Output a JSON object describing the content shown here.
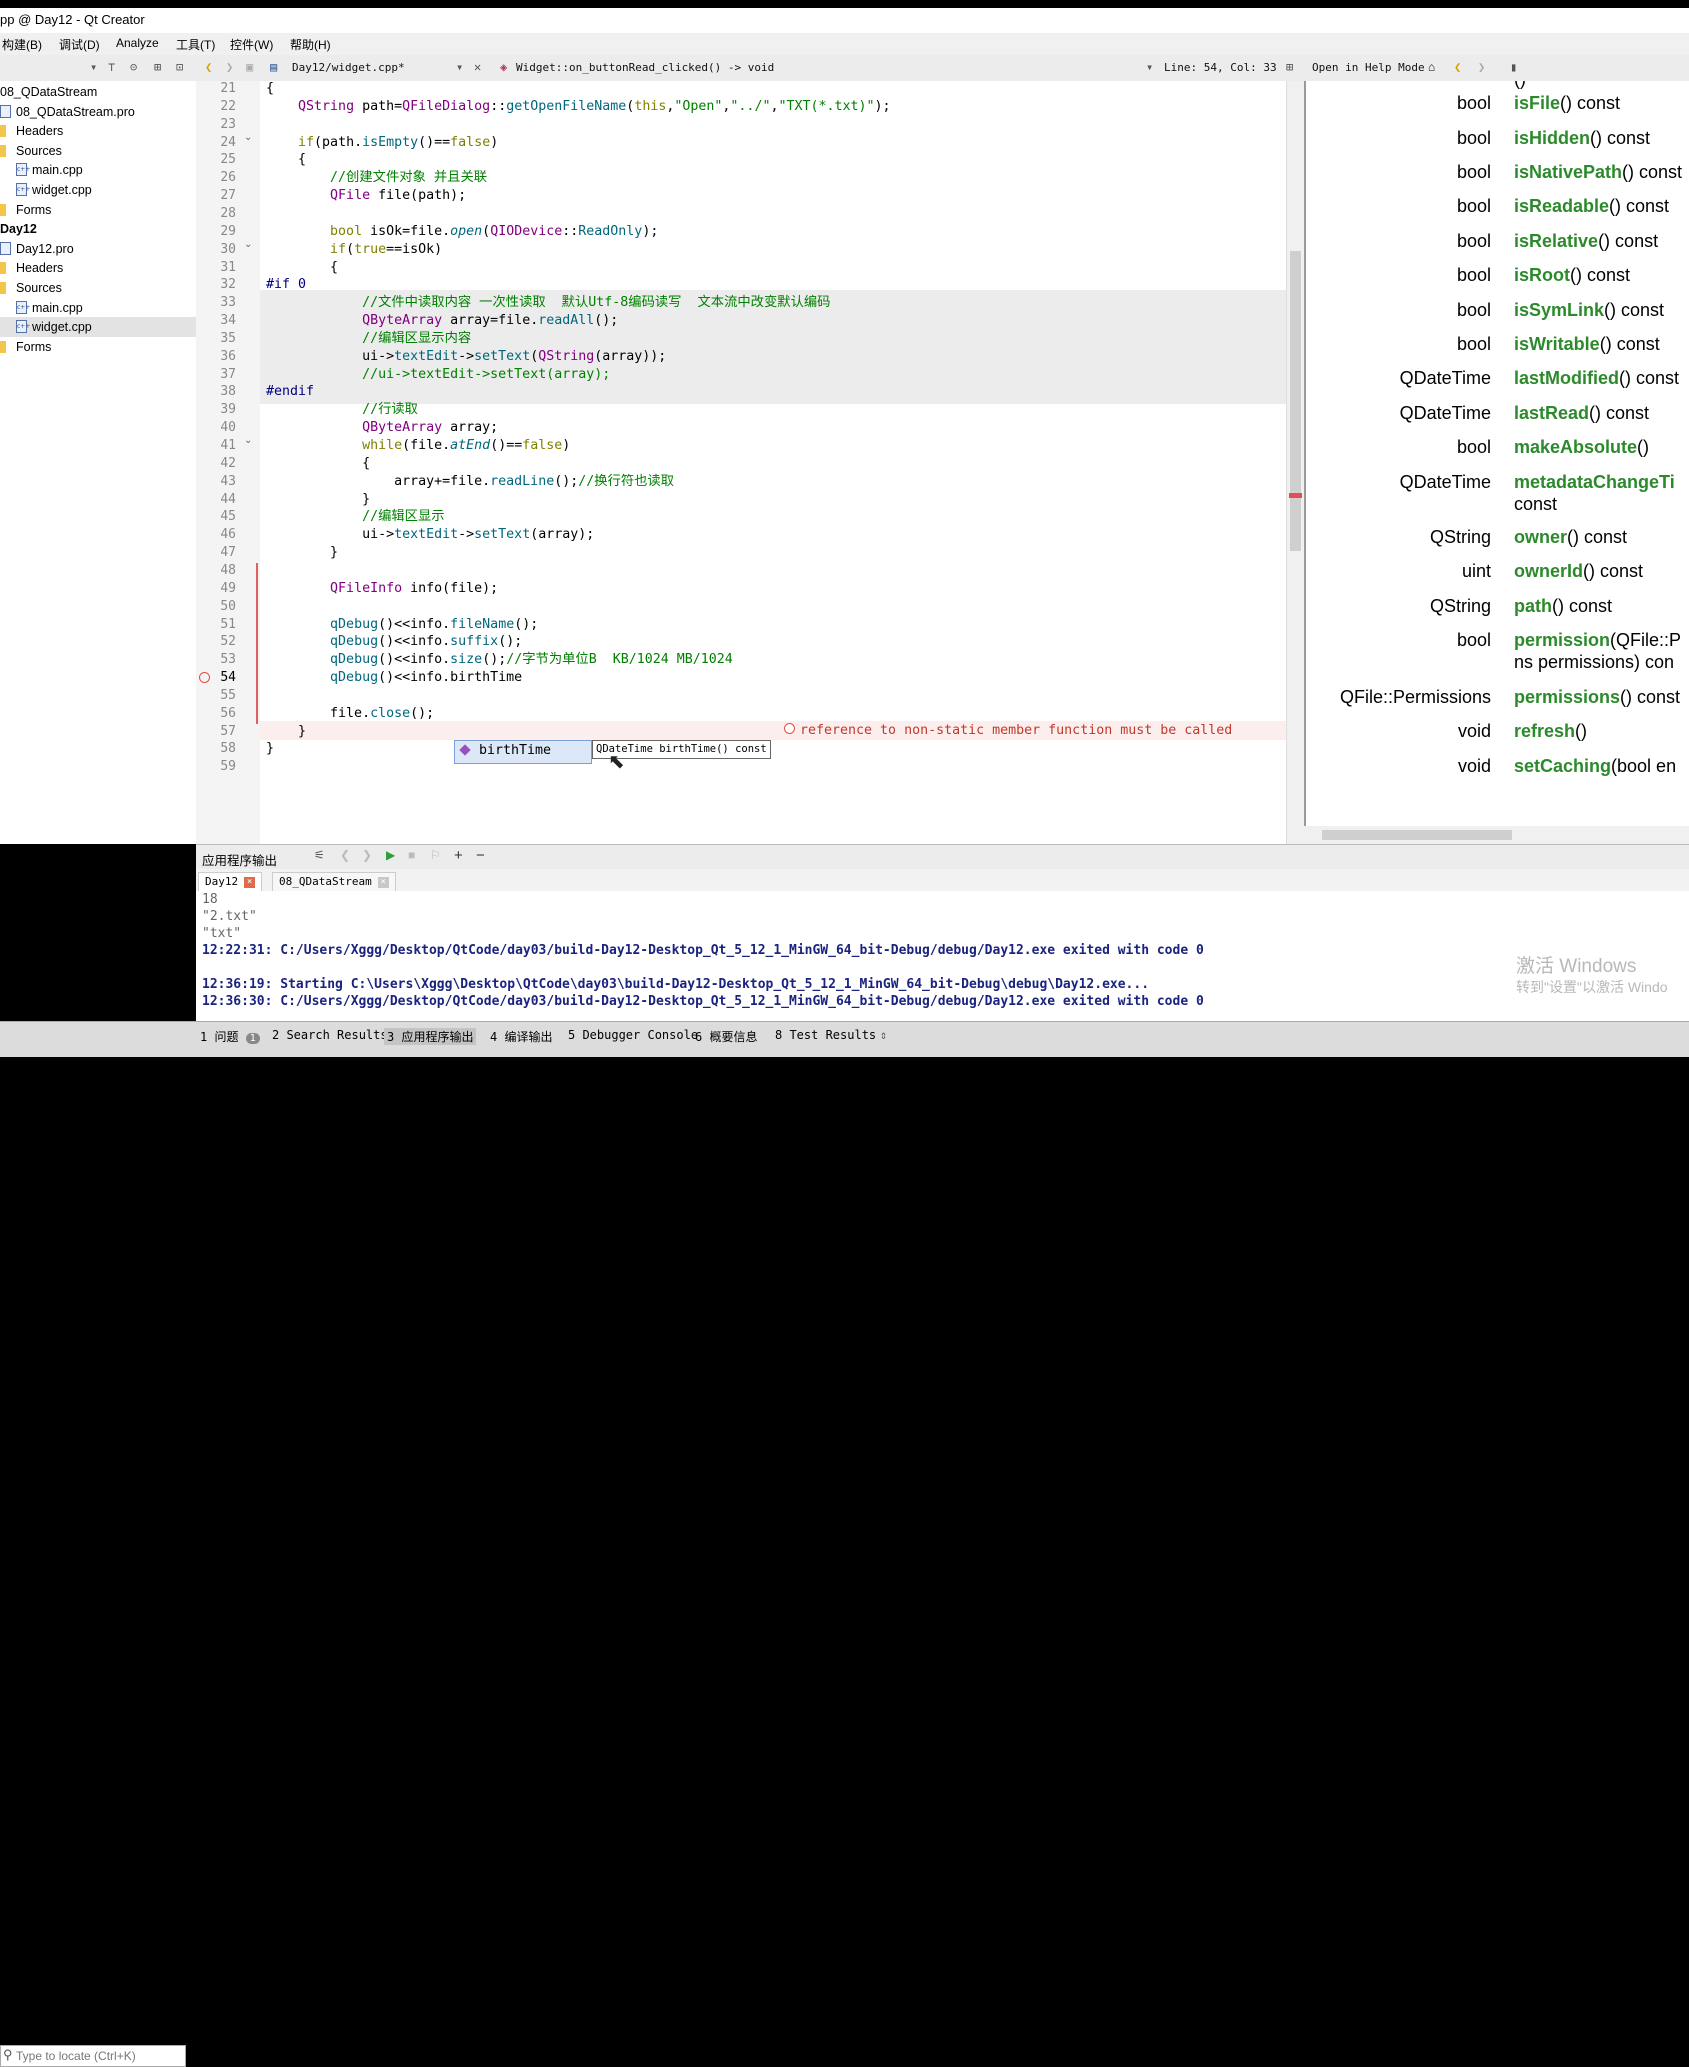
{
  "window": {
    "title": "pp @ Day12 - Qt Creator"
  },
  "menu": [
    "构建(B)",
    "调试(D)",
    "Analyze",
    "工具(T)",
    "控件(W)",
    "帮助(H)"
  ],
  "toolbar": {
    "file": "Day12/widget.cpp*",
    "symbol": "Widget::on_buttonRead_clicked() -> void",
    "position": "Line: 54, Col: 33",
    "help_mode": "Open in Help Mode"
  },
  "tree": [
    {
      "label": "08_QDataStream",
      "icon": "project-icon",
      "bold": false,
      "sel": false
    },
    {
      "label": "08_QDataStream.pro",
      "icon": "pro-file-icon",
      "bold": false,
      "sel": false
    },
    {
      "label": "Headers",
      "icon": "folder-icon",
      "bold": false,
      "sel": false
    },
    {
      "label": "Sources",
      "icon": "folder-icon",
      "bold": false,
      "sel": false
    },
    {
      "label": "main.cpp",
      "icon": "cpp-file-icon",
      "bold": false,
      "sel": false
    },
    {
      "label": "widget.cpp",
      "icon": "cpp-file-icon",
      "bold": false,
      "sel": false
    },
    {
      "label": "Forms",
      "icon": "folder-icon",
      "bold": false,
      "sel": false
    },
    {
      "label": "Day12",
      "icon": "project-icon",
      "bold": true,
      "sel": false
    },
    {
      "label": "Day12.pro",
      "icon": "pro-file-icon",
      "bold": false,
      "sel": false
    },
    {
      "label": "Headers",
      "icon": "folder-icon",
      "bold": false,
      "sel": false
    },
    {
      "label": "Sources",
      "icon": "folder-icon",
      "bold": false,
      "sel": false
    },
    {
      "label": "main.cpp",
      "icon": "cpp-file-icon",
      "bold": false,
      "sel": false
    },
    {
      "label": "widget.cpp",
      "icon": "cpp-file-icon",
      "bold": false,
      "sel": true
    },
    {
      "label": "Forms",
      "icon": "folder-icon",
      "bold": false,
      "sel": false
    }
  ],
  "editor": {
    "line_numbers": [
      "21",
      "22",
      "23",
      "24",
      "25",
      "26",
      "27",
      "28",
      "29",
      "30",
      "31",
      "32",
      "33",
      "34",
      "35",
      "36",
      "37",
      "38",
      "39",
      "40",
      "41",
      "42",
      "43",
      "44",
      "45",
      "46",
      "47",
      "48",
      "49",
      "50",
      "51",
      "52",
      "53",
      "54",
      "55",
      "56",
      "57",
      "58",
      "59"
    ],
    "lines": [
      "{",
      "    QString path=QFileDialog::getOpenFileName(this,\"Open\",\"../\",\"TXT(*.txt)\");",
      "",
      "    if(path.isEmpty()==false)",
      "    {",
      "        //创建文件对象 并且关联",
      "        QFile file(path);",
      "",
      "        bool isOk=file.open(QIODevice::ReadOnly);",
      "        if(true==isOk)",
      "        {",
      "#if 0",
      "            //文件中读取内容 一次性读取  默认Utf-8编码读写  文本流中改变默认编码",
      "            QByteArray array=file.readAll();",
      "            //编辑区显示内容",
      "            ui->textEdit->setText(QString(array));",
      "            //ui->textEdit->setText(array);",
      "#endif",
      "            //行读取",
      "            QByteArray array;",
      "            while(file.atEnd()==false)",
      "            {",
      "                array+=file.readLine();//换行符也读取",
      "            }",
      "            //编辑区显示",
      "            ui->textEdit->setText(array);",
      "        }",
      "",
      "        QFileInfo info(file);",
      "",
      "        qDebug()<<info.fileName();",
      "        qDebug()<<info.suffix();",
      "        qDebug()<<info.size();//字节为单位B  KB/1024 MB/1024",
      "        qDebug()<<info.birthTime",
      "",
      "        file.close();",
      "    }",
      "}",
      ""
    ],
    "error": "reference to non-static member function must be called",
    "completion": "birthTime",
    "tooltip": "QDateTime birthTime() const"
  },
  "help": [
    {
      "ret": "",
      "name": "",
      "rest": "()"
    },
    {
      "ret": "bool",
      "name": "isFile",
      "rest": "() const"
    },
    {
      "ret": "bool",
      "name": "isHidden",
      "rest": "() const"
    },
    {
      "ret": "bool",
      "name": "isNativePath",
      "rest": "() const"
    },
    {
      "ret": "bool",
      "name": "isReadable",
      "rest": "() const"
    },
    {
      "ret": "bool",
      "name": "isRelative",
      "rest": "() const"
    },
    {
      "ret": "bool",
      "name": "isRoot",
      "rest": "() const"
    },
    {
      "ret": "bool",
      "name": "isSymLink",
      "rest": "() const"
    },
    {
      "ret": "bool",
      "name": "isWritable",
      "rest": "() const"
    },
    {
      "ret": "QDateTime",
      "name": "lastModified",
      "rest": "() const"
    },
    {
      "ret": "QDateTime",
      "name": "lastRead",
      "rest": "() const"
    },
    {
      "ret": "bool",
      "name": "makeAbsolute",
      "rest": "()"
    },
    {
      "ret": "QDateTime",
      "name": "metadataChangeTi",
      "rest": "",
      "line2": "const"
    },
    {
      "ret": "QString",
      "name": "owner",
      "rest": "() const"
    },
    {
      "ret": "uint",
      "name": "ownerId",
      "rest": "() const"
    },
    {
      "ret": "QString",
      "name": "path",
      "rest": "() const"
    },
    {
      "ret": "bool",
      "name": "permission",
      "rest": "(QFile::P",
      "line2": "ns permissions) con"
    },
    {
      "ret": "QFile::Permissions",
      "name": "permissions",
      "rest": "() const"
    },
    {
      "ret": "void",
      "name": "refresh",
      "rest": "()"
    },
    {
      "ret": "void",
      "name": "setCaching",
      "rest": "(bool en"
    }
  ],
  "output": {
    "title": "应用程序输出",
    "tabs": [
      "Day12",
      "08_QDataStream"
    ],
    "lines": [
      {
        "text": "18",
        "style": "grey"
      },
      {
        "text": "\"2.txt\"",
        "style": "grey"
      },
      {
        "text": "\"txt\"",
        "style": "grey"
      },
      {
        "text": "12:22:31: C:/Users/Xggg/Desktop/QtCode/day03/build-Day12-Desktop_Qt_5_12_1_MinGW_64_bit-Debug/debug/Day12.exe exited with code 0",
        "style": "bold"
      },
      {
        "text": "",
        "style": "grey"
      },
      {
        "text": "12:36:19: Starting C:\\Users\\Xggg\\Desktop\\QtCode\\day03\\build-Day12-Desktop_Qt_5_12_1_MinGW_64_bit-Debug\\debug\\Day12.exe...",
        "style": "bold"
      },
      {
        "text": "12:36:30: C:/Users/Xggg/Desktop/QtCode/day03/build-Day12-Desktop_Qt_5_12_1_MinGW_64_bit-Debug/debug/Day12.exe exited with code 0",
        "style": "bold"
      }
    ]
  },
  "watermark": {
    "line1": "激活 Windows",
    "line2": "转到\"设置\"以激活 Windo"
  },
  "status": {
    "locate_placeholder": "Type to locate (Ctrl+K)",
    "tabs": [
      "1 问题",
      "2 Search Results",
      "3 应用程序输出",
      "4 编译输出",
      "5 Debugger Console",
      "6 概要信息",
      "8 Test Results"
    ],
    "issues_count": "1"
  }
}
